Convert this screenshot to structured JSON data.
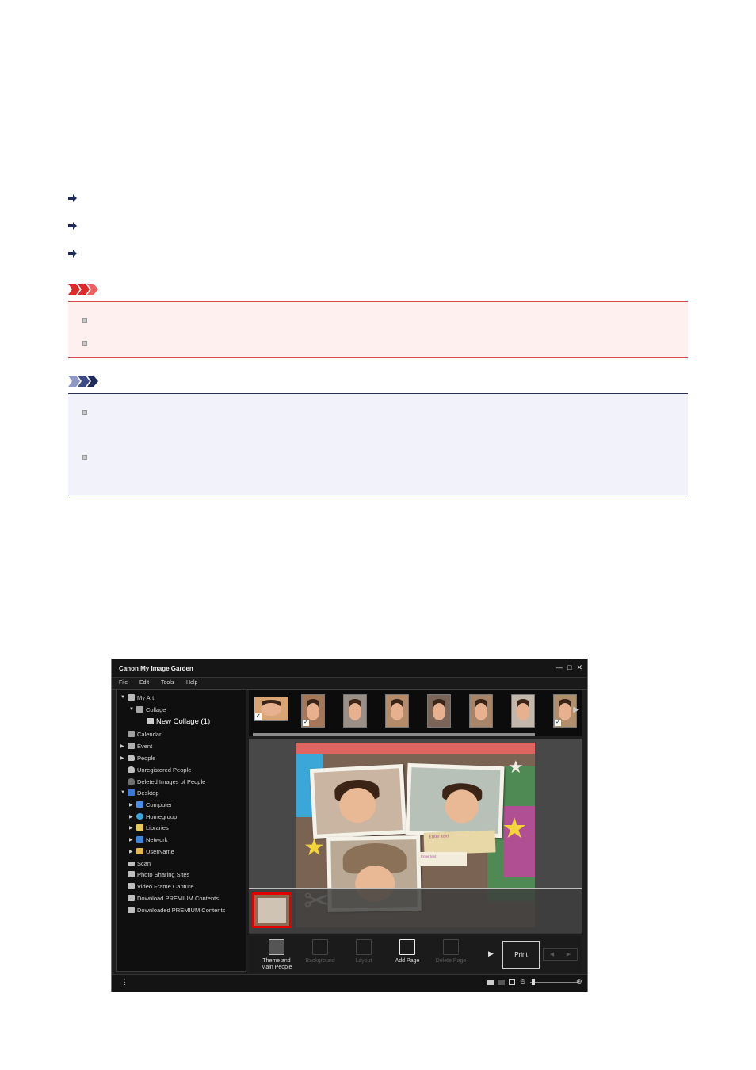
{
  "links": [
    {
      "label": ""
    },
    {
      "label": ""
    },
    {
      "label": ""
    }
  ],
  "important": {
    "bullets": [
      "",
      ""
    ]
  },
  "note": {
    "bullets": [
      "",
      ""
    ]
  },
  "app": {
    "title": "Canon My Image Garden",
    "window_buttons": [
      "—",
      "□",
      "✕"
    ],
    "menu": [
      "File",
      "Edit",
      "Tools",
      "Help"
    ],
    "tree": [
      {
        "label": "My Art",
        "twisty": "▼",
        "icon_color": "#b8b8b8"
      },
      {
        "label": "Collage",
        "twisty": "▼",
        "icon_color": "#a8a8a8"
      },
      {
        "label": "New Collage (1)",
        "twisty": "",
        "icon_color": "#cccccc"
      },
      {
        "label": "Calendar",
        "twisty": "",
        "icon_color": "#9e9e9e"
      },
      {
        "label": "Event",
        "twisty": "▶",
        "icon_color": "#b0b0b0"
      },
      {
        "label": "People",
        "twisty": "▶",
        "icon_color": "#c0c0c0"
      },
      {
        "label": "Unregistered People",
        "twisty": "",
        "icon_color": "#c0c0c0"
      },
      {
        "label": "Deleted Images of People",
        "twisty": "",
        "icon_color": "#707070"
      },
      {
        "label": "Desktop",
        "twisty": "▼",
        "icon_color": "#3b7bd6"
      },
      {
        "label": "Computer",
        "twisty": "▶",
        "icon_color": "#4c8fe0"
      },
      {
        "label": "Homegroup",
        "twisty": "▶",
        "icon_color": "#39a6d9"
      },
      {
        "label": "Libraries",
        "twisty": "▶",
        "icon_color": "#e9c85b"
      },
      {
        "label": "Network",
        "twisty": "▶",
        "icon_color": "#3f86d8"
      },
      {
        "label": "UserName",
        "twisty": "▶",
        "icon_color": "#e0b84c"
      },
      {
        "label": "Scan",
        "twisty": "",
        "icon_color": "#bdbdbd"
      },
      {
        "label": "Photo Sharing Sites",
        "twisty": "",
        "icon_color": "#bdbdbd"
      },
      {
        "label": "Video Frame Capture",
        "twisty": "",
        "icon_color": "#bdbdbd"
      },
      {
        "label": "Download PREMIUM Contents",
        "twisty": "",
        "icon_color": "#bdbdbd"
      },
      {
        "label": "Downloaded PREMIUM Contents",
        "twisty": "",
        "icon_color": "#bdbdbd"
      }
    ],
    "collage_text": {
      "enter_text": "Enter text",
      "small_text": "Enter text"
    },
    "tools": [
      {
        "label": "Theme and Main People",
        "enabled": true
      },
      {
        "label": "Background",
        "enabled": false
      },
      {
        "label": "Layout",
        "enabled": false
      },
      {
        "label": "Add Page",
        "enabled": true
      },
      {
        "label": "Delete Page",
        "enabled": false
      }
    ],
    "print_label": "Print"
  }
}
